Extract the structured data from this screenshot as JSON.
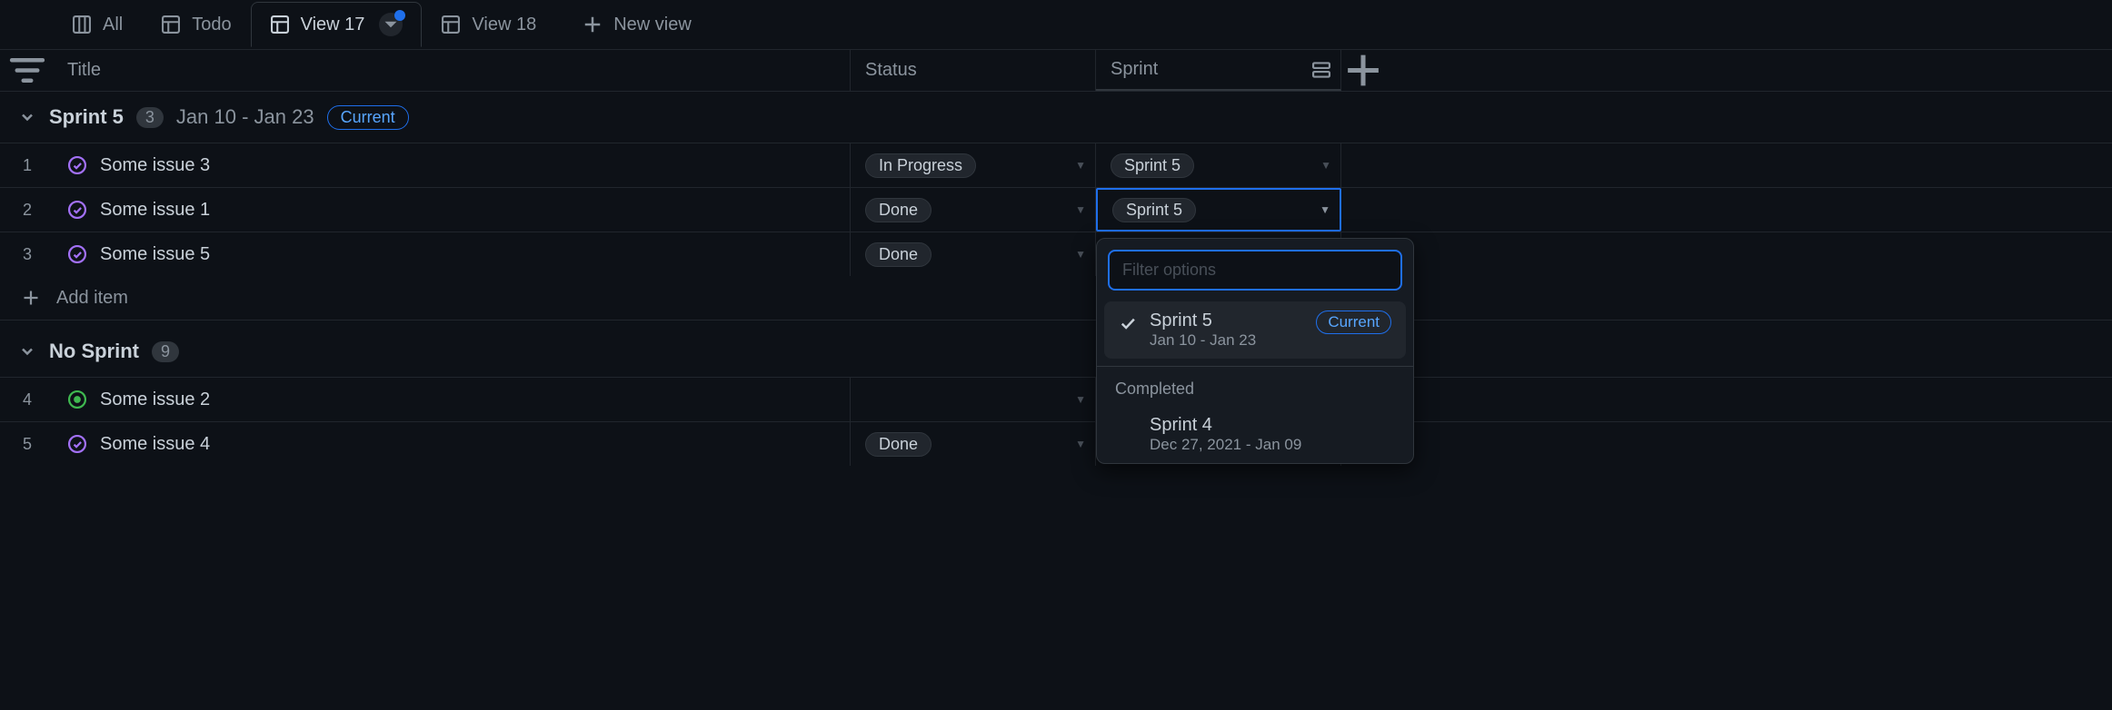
{
  "tabs": [
    {
      "label": "All",
      "icon": "board"
    },
    {
      "label": "Todo",
      "icon": "table"
    },
    {
      "label": "View 17",
      "icon": "table",
      "active": true,
      "has_indicator": true
    },
    {
      "label": "View 18",
      "icon": "table"
    }
  ],
  "new_view_label": "New view",
  "columns": {
    "title": "Title",
    "status": "Status",
    "sprint": "Sprint"
  },
  "groups": [
    {
      "title": "Sprint 5",
      "count": "3",
      "date_range": "Jan 10 - Jan 23",
      "badge": "Current",
      "rows": [
        {
          "num": "1",
          "title": "Some issue 3",
          "icon": "closed-purple",
          "status": "In Progress",
          "sprint": "Sprint 5"
        },
        {
          "num": "2",
          "title": "Some issue 1",
          "icon": "closed-purple",
          "status": "Done",
          "sprint": "Sprint 5",
          "sprint_selected": true
        },
        {
          "num": "3",
          "title": "Some issue 5",
          "icon": "closed-purple",
          "status": "Done",
          "sprint": ""
        }
      ]
    },
    {
      "title": "No Sprint",
      "count": "9",
      "rows": [
        {
          "num": "4",
          "title": "Some issue 2",
          "icon": "open-green",
          "status": "",
          "sprint": ""
        },
        {
          "num": "5",
          "title": "Some issue 4",
          "icon": "closed-purple",
          "status": "Done",
          "sprint": ""
        }
      ]
    }
  ],
  "add_item_label": "Add item",
  "popover": {
    "filter_placeholder": "Filter options",
    "options": [
      {
        "label": "Sprint 5",
        "sub": "Jan 10 - Jan 23",
        "badge": "Current",
        "checked": true,
        "highlighted": true
      }
    ],
    "section_label": "Completed",
    "completed": [
      {
        "label": "Sprint 4",
        "sub": "Dec 27, 2021 - Jan 09"
      }
    ]
  }
}
